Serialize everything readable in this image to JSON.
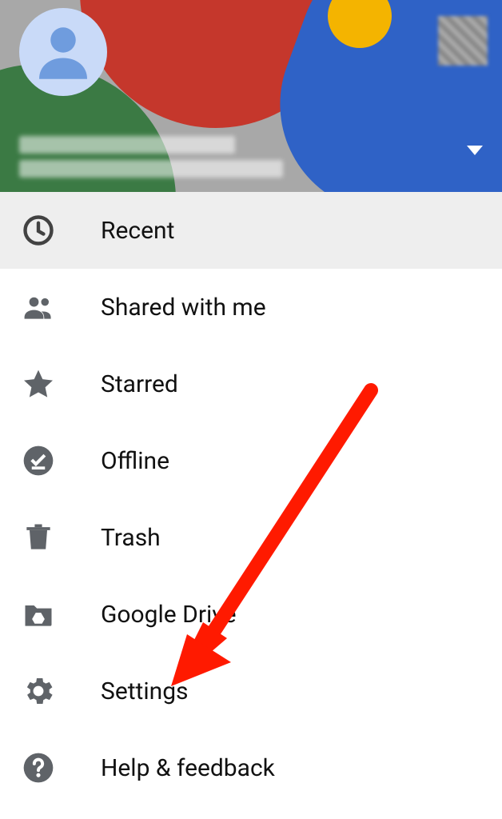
{
  "header": {
    "user_name_placeholder": "",
    "user_email_placeholder": ""
  },
  "menu": {
    "items": [
      {
        "label": "Recent",
        "icon": "clock",
        "selected": true
      },
      {
        "label": "Shared with me",
        "icon": "people",
        "selected": false
      },
      {
        "label": "Starred",
        "icon": "star",
        "selected": false
      },
      {
        "label": "Offline",
        "icon": "offline-pin",
        "selected": false
      },
      {
        "label": "Trash",
        "icon": "trash",
        "selected": false
      },
      {
        "label": "Google Drive",
        "icon": "drive-folder",
        "selected": false
      },
      {
        "label": "Settings",
        "icon": "gear",
        "selected": false
      },
      {
        "label": "Help & feedback",
        "icon": "help",
        "selected": false
      }
    ]
  },
  "annotation": {
    "arrow_target": "Settings",
    "arrow_color": "#ff0000"
  }
}
